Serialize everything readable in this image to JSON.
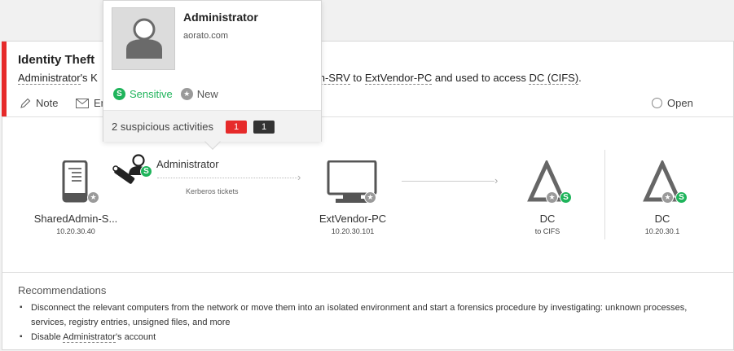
{
  "alert": {
    "title": "Identity Theft",
    "description": {
      "user": "Administrator",
      "prefix_tail": "'s K",
      "mid_hidden": "",
      "source_tail": "min-SRV",
      "to_word": " to ",
      "target": "ExtVendor-PC",
      "used_phrase": " and used to access ",
      "resource": "DC (CIFS)",
      "end": "."
    },
    "actions": {
      "note_label": "Note",
      "email_label": "Em",
      "open_label": "Open"
    },
    "accent_color": "#e62a2a"
  },
  "flow": {
    "source": {
      "name": "SharedAdmin-S...",
      "ip": "10.20.30.40",
      "icon": "server-icon"
    },
    "account": {
      "name": "Administrator",
      "icon": "user-key-icon",
      "tag": "S"
    },
    "transport_label": "Kerberos tickets",
    "destination": {
      "name": "ExtVendor-PC",
      "ip": "10.20.30.101",
      "icon": "monitor-icon"
    },
    "resource": {
      "name": "DC",
      "sub": "to CIFS",
      "icon": "domain-controller-icon",
      "tag": "S"
    },
    "resource2": {
      "name": "DC",
      "ip": "10.20.30.1",
      "icon": "domain-controller-icon",
      "tag": "S"
    }
  },
  "recommendations": {
    "title": "Recommendations",
    "items": [
      "Disconnect the relevant computers from the network or move them into an isolated environment and start a forensics procedure by investigating: unknown processes, services, registry entries, unsigned files, and more",
      "Disable Administrator's account"
    ],
    "item2_parts": {
      "pre": "Disable ",
      "user": "Administrator",
      "post": "'s account"
    }
  },
  "popover": {
    "name": "Administrator",
    "domain": "aorato.com",
    "tag_sensitive": "Sensitive",
    "tag_new": "New",
    "activities_label": "2 suspicious activities",
    "count_open": "1",
    "count_closed": "1",
    "sensitive_color": "#1fb45b",
    "open_color": "#e62a2a",
    "closed_color": "#333333"
  }
}
